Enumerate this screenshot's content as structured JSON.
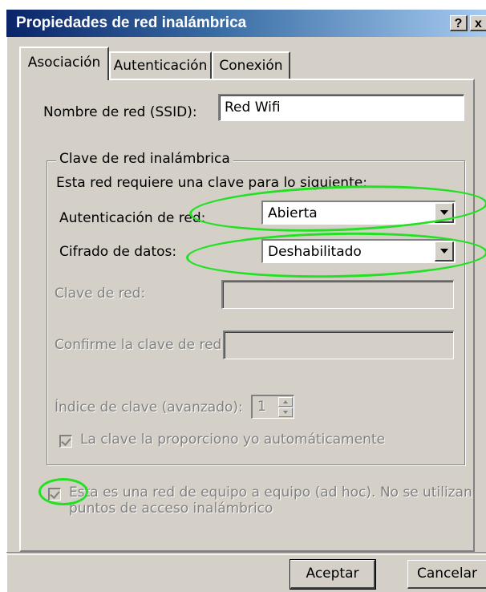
{
  "window": {
    "title": "Propiedades de red inalámbrica",
    "help_button": "?",
    "close_button": "x"
  },
  "tabs": [
    {
      "label": "Asociación",
      "active": true
    },
    {
      "label": "Autenticación",
      "active": false
    },
    {
      "label": "Conexión",
      "active": false
    }
  ],
  "ssid": {
    "label": "Nombre de red (SSID):",
    "value": "Red Wifi"
  },
  "network_key_group": {
    "legend": "Clave de red inalámbrica",
    "description": "Esta red requiere una clave para lo siguiente:",
    "auth": {
      "label": "Autenticación de red:",
      "value": "Abierta"
    },
    "encryption": {
      "label": "Cifrado de datos:",
      "value": "Deshabilitado"
    },
    "network_key": {
      "label": "Clave de red:",
      "value": ""
    },
    "confirm_key": {
      "label": "Confirme la clave de red:",
      "value": ""
    },
    "key_index": {
      "label": "Índice de clave (avanzado):",
      "value": "1"
    },
    "auto_key": {
      "label": "La clave la proporciono yo automáticamente",
      "checked": true,
      "enabled": false
    }
  },
  "adhoc": {
    "label_line1": "Esta es una red de equipo a equipo (ad hoc). No se utilizan",
    "label_line2": "puntos de acceso inalámbrico",
    "checked": true,
    "enabled": false
  },
  "buttons": {
    "accept": "Aceptar",
    "cancel": "Cancelar"
  },
  "colors": {
    "annotation": "#22e022",
    "dialog_face": "#d4d0c8",
    "title_gradient_start": "#0a246a",
    "title_gradient_end": "#a6caf0"
  }
}
